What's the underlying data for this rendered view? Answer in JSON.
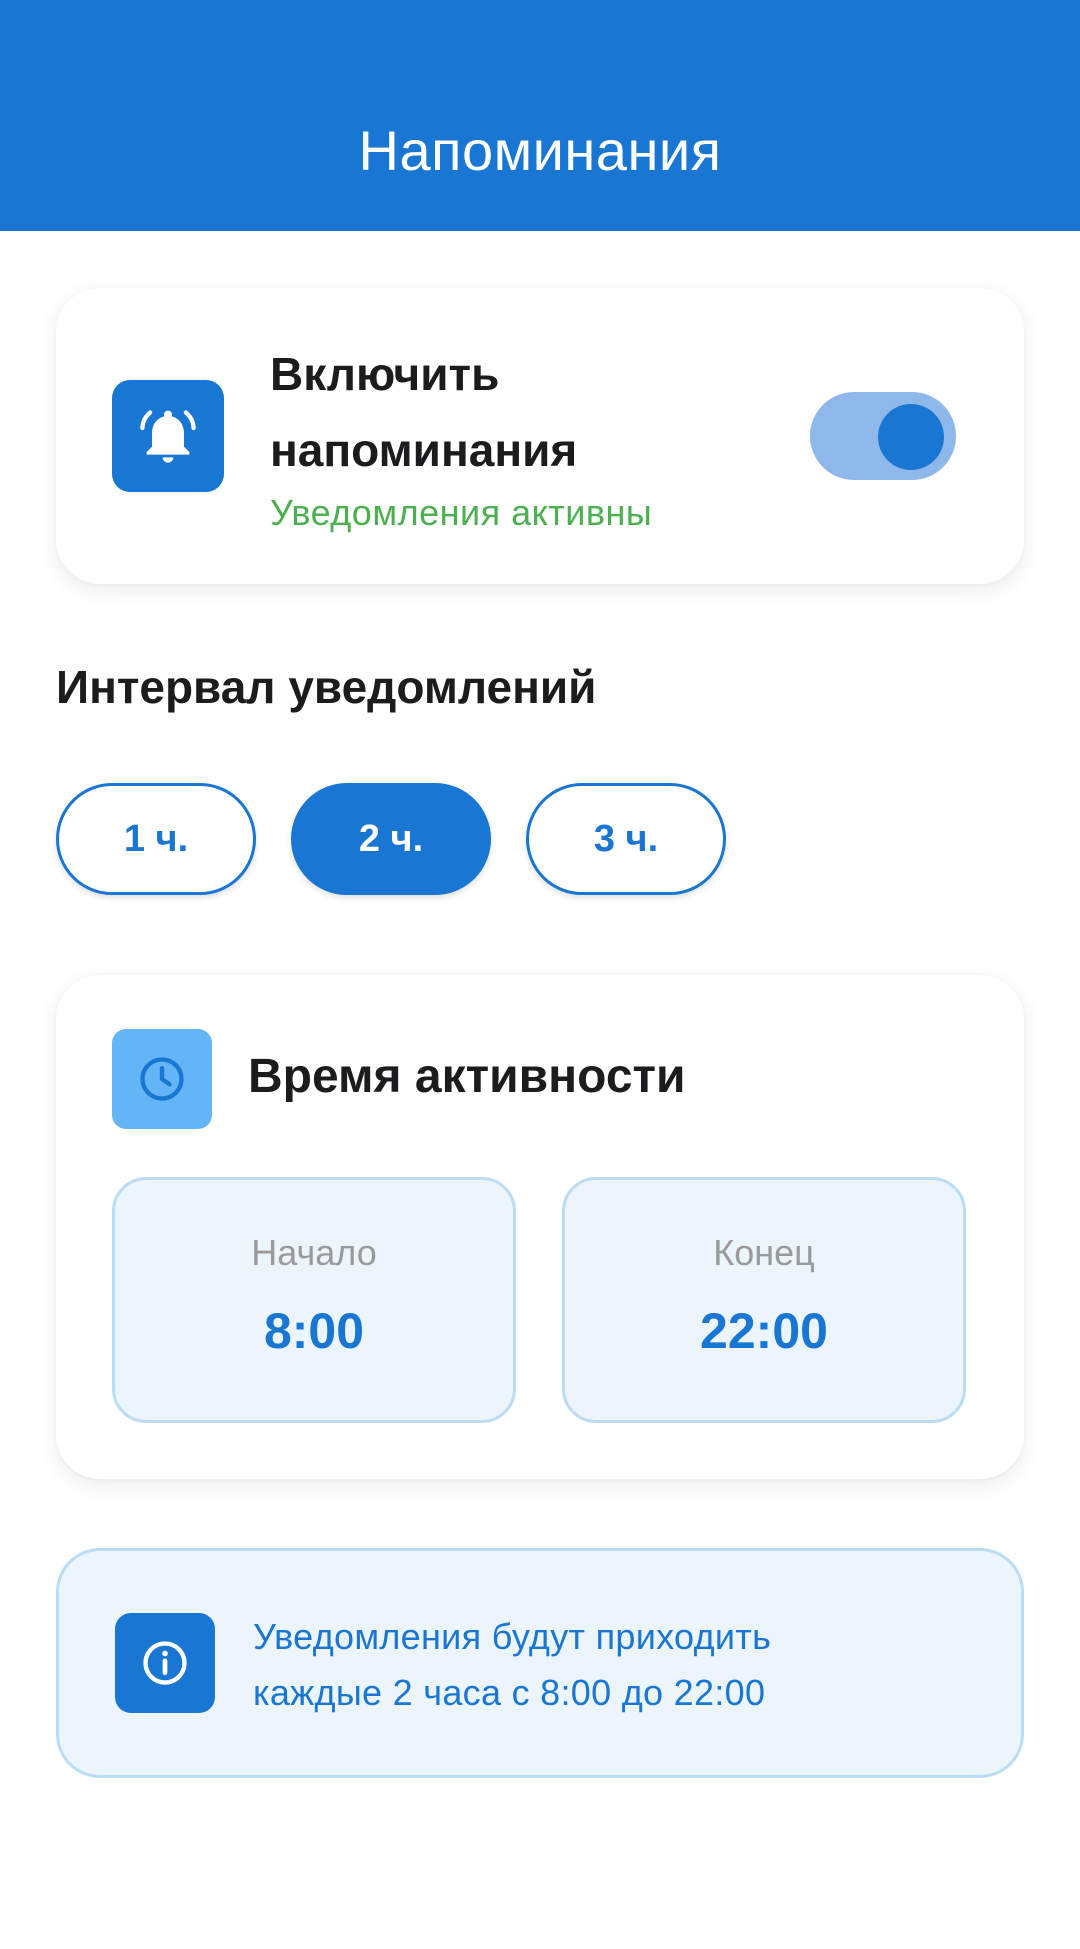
{
  "appbar": {
    "title": "Напоминания"
  },
  "enable": {
    "title": "Включить напоминания",
    "status": "Уведомления активны",
    "toggle_on": true,
    "icon": "bell-icon"
  },
  "interval": {
    "title": "Интервал уведомлений",
    "options": [
      "1 ч.",
      "2 ч.",
      "3 ч."
    ],
    "selected": "2 ч."
  },
  "active_time": {
    "title": "Время активности",
    "icon": "clock-icon",
    "start_label": "Начало",
    "start_value": "8:00",
    "end_label": "Конец",
    "end_value": "22:00"
  },
  "info": {
    "icon": "info-icon",
    "line1": "Уведомления будут приходить",
    "line2": "каждые 2 часа с 8:00 до 22:00"
  },
  "colors": {
    "primary": "#1976D2",
    "status_active": "#4CAF50",
    "toggle_track": "#8DB8E9",
    "light_blue_icon": "#64B5F6",
    "panel_bg": "#EDF5FC"
  }
}
